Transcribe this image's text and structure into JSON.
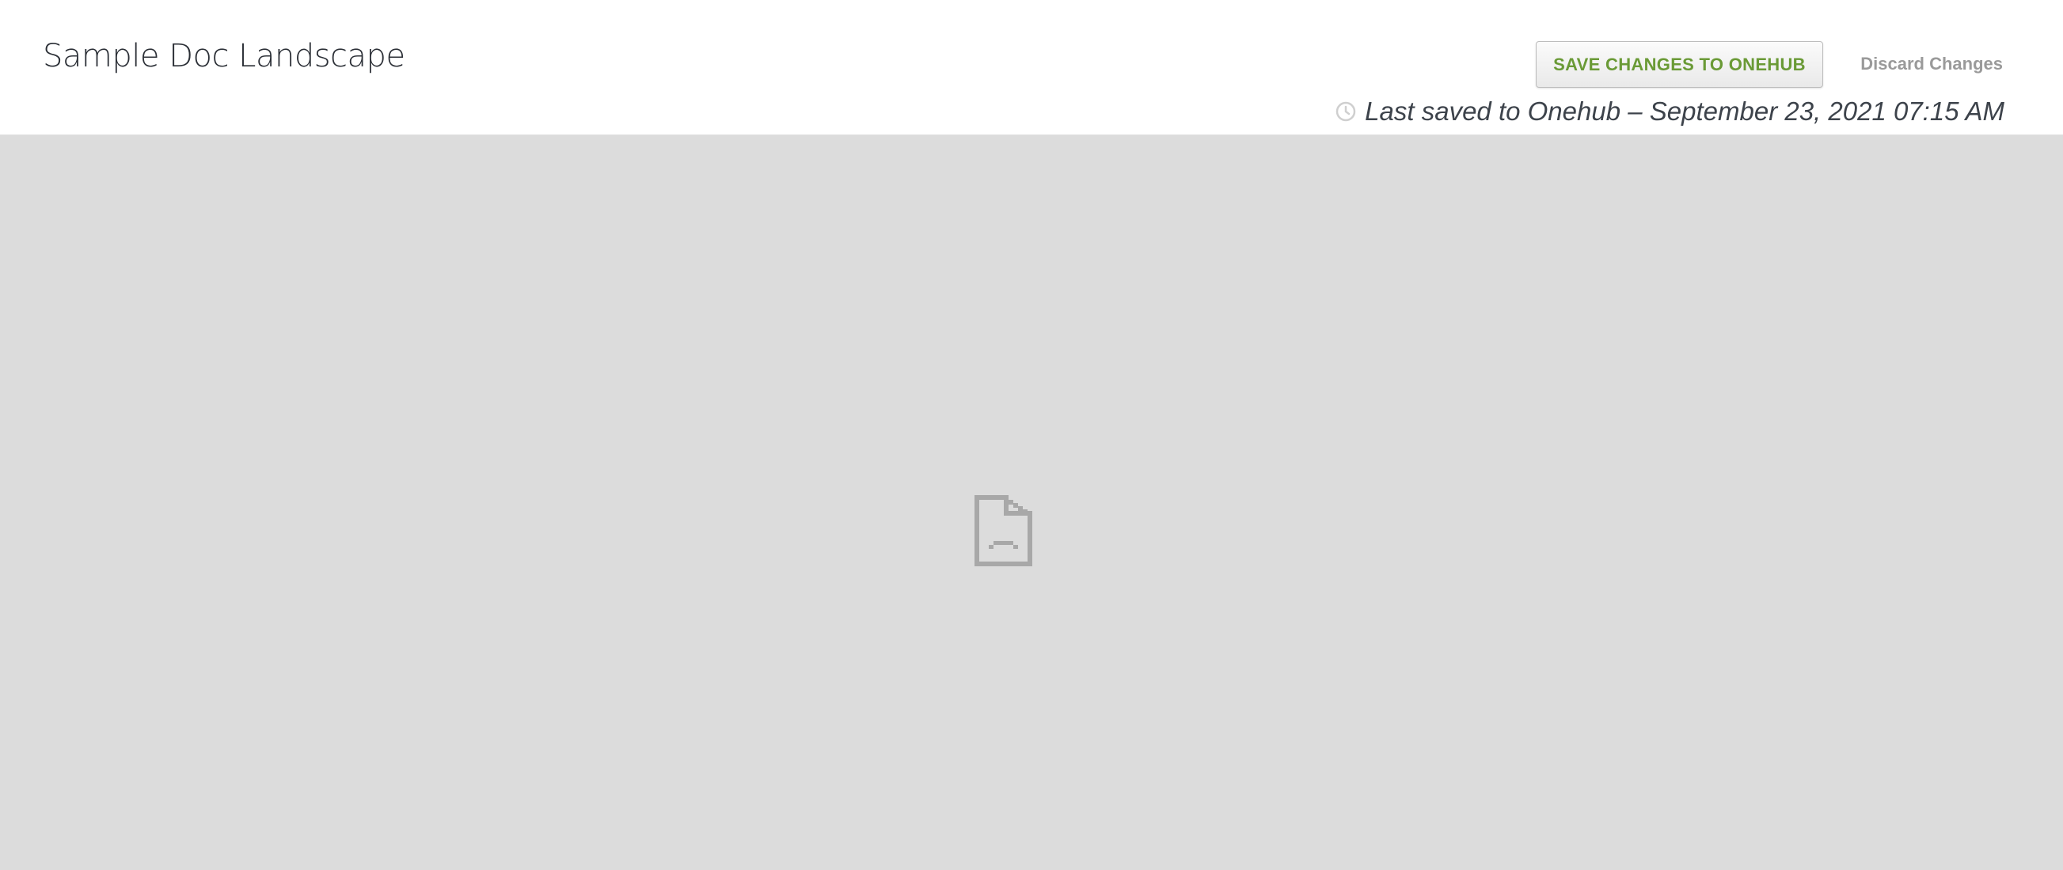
{
  "document": {
    "title": "Sample Doc Landscape"
  },
  "toolbar": {
    "save_label": "SAVE CHANGES TO ONEHUB",
    "discard_label": "Discard Changes"
  },
  "status": {
    "icon": "clock-icon",
    "last_saved_text": "Last saved to Onehub – September 23, 2021 07:15 AM"
  },
  "viewer": {
    "placeholder_icon": "broken-document-icon"
  },
  "colors": {
    "save_label": "#6a9a36",
    "viewer_background": "#dcdcdc",
    "discard_label": "#9a9a9a"
  }
}
